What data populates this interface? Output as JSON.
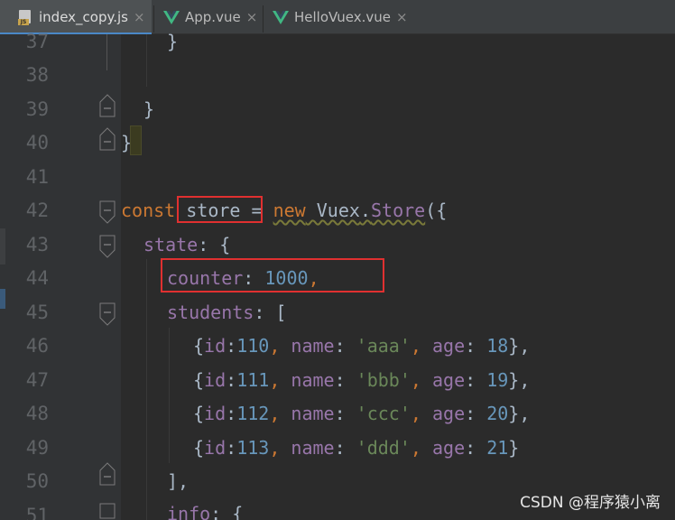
{
  "tabs": [
    {
      "label": "index_copy.js",
      "icon": "javascript-file-icon",
      "active": true
    },
    {
      "label": "App.vue",
      "icon": "vue-file-icon",
      "active": false
    },
    {
      "label": "HelloVuex.vue",
      "icon": "vue-file-icon",
      "active": false
    }
  ],
  "tab_close_glyph": "×",
  "line_numbers": [
    "37",
    "38",
    "39",
    "40",
    "41",
    "42",
    "43",
    "44",
    "45",
    "46",
    "47",
    "48",
    "49",
    "50",
    "51"
  ],
  "code": {
    "l37": {
      "t0": "}"
    },
    "l39": {
      "t0": "}"
    },
    "l40": {
      "t0": "}"
    },
    "l42": {
      "t0": "const",
      "t1": " store",
      "t2": " = ",
      "t3": "new",
      "t4": " Vuex",
      "t5": ".",
      "t6": "Store",
      "t7": "({"
    },
    "l43": {
      "t0": "state",
      "t1": ": {"
    },
    "l44": {
      "t0": "counter",
      "t1": ": ",
      "t2": "1000",
      "t3": ","
    },
    "l45": {
      "t0": "students",
      "t1": ": ["
    },
    "l46": {
      "t0": "{",
      "t1": "id",
      "t2": ":",
      "t3": "110",
      "t4": ", ",
      "t5": "name",
      "t6": ": ",
      "t7": "'aaa'",
      "t8": ", ",
      "t9": "age",
      "t10": ": ",
      "t11": "18",
      "t12": "},"
    },
    "l47": {
      "t0": "{",
      "t1": "id",
      "t2": ":",
      "t3": "111",
      "t4": ", ",
      "t5": "name",
      "t6": ": ",
      "t7": "'bbb'",
      "t8": ", ",
      "t9": "age",
      "t10": ": ",
      "t11": "19",
      "t12": "},"
    },
    "l48": {
      "t0": "{",
      "t1": "id",
      "t2": ":",
      "t3": "112",
      "t4": ", ",
      "t5": "name",
      "t6": ": ",
      "t7": "'ccc'",
      "t8": ", ",
      "t9": "age",
      "t10": ": ",
      "t11": "20",
      "t12": "},"
    },
    "l49": {
      "t0": "{",
      "t1": "id",
      "t2": ":",
      "t3": "113",
      "t4": ", ",
      "t5": "name",
      "t6": ": ",
      "t7": "'ddd'",
      "t8": ", ",
      "t9": "age",
      "t10": ": ",
      "t11": "21",
      "t12": "}"
    },
    "l50": {
      "t0": "],"
    },
    "l51": {
      "t0": "info",
      "t1": ": {"
    }
  },
  "watermark": "CSDN @程序猿小离",
  "colors": {
    "keyword": "#cc7832",
    "property": "#9876aa",
    "number": "#6897bb",
    "string": "#6a8759",
    "highlight_box": "#e03030"
  }
}
